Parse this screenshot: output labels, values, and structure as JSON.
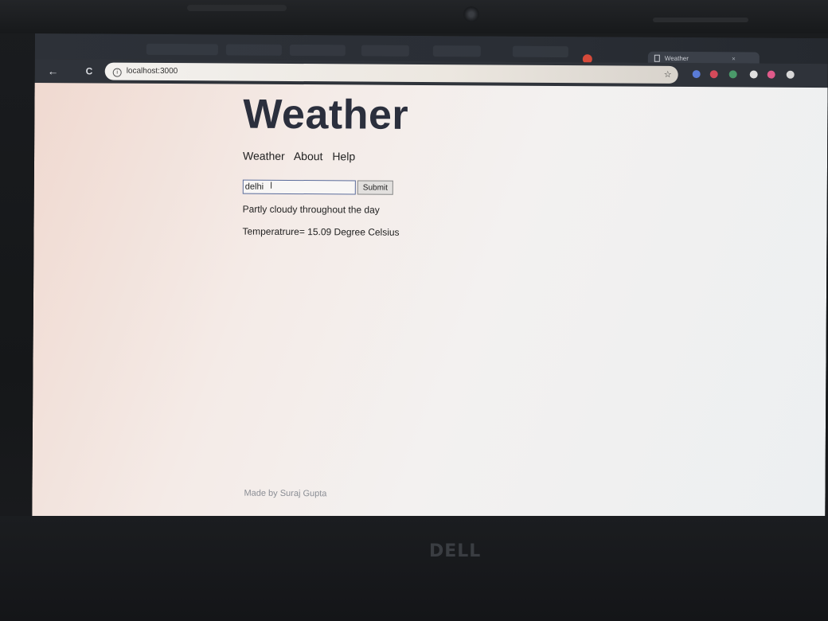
{
  "browser": {
    "tab_title": "Weather",
    "tab_close": "×",
    "back_icon": "←",
    "reload_icon": "C",
    "url": "localhost:3000",
    "info_icon": "i",
    "star_icon": "☆"
  },
  "page": {
    "title": "Weather",
    "nav": [
      "Weather",
      "About",
      "Help"
    ],
    "search": {
      "value": "delhi",
      "submit_label": "Submit"
    },
    "forecast": "Partly cloudy throughout the day",
    "temperature": "Temperatrure= 15.09 Degree Celsius",
    "footer": "Made by Suraj Gupta"
  },
  "device": {
    "brand": "DELL"
  },
  "colors": {
    "title": "#2b2f3d",
    "input_border": "#5a6b9a",
    "footer_text": "#8a8d94"
  }
}
